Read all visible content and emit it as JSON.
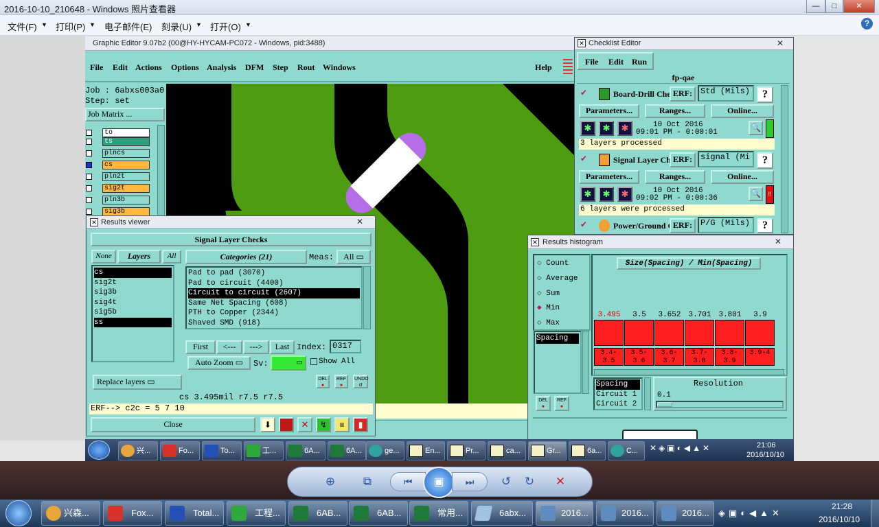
{
  "viewer": {
    "title": "2016-10-10_210648 - Windows 照片查看器",
    "menus": [
      "文件(F)",
      "打印(P)",
      "电子邮件(E)",
      "刻录(U)",
      "打开(O)"
    ],
    "help": "?",
    "min": "—",
    "max": "□",
    "close": "✕"
  },
  "graphic_editor": {
    "title": "Graphic Editor 9.07b2 (00@HY-HYCAM-PC072 - Windows, pid:3488)",
    "menus": [
      "File",
      "Edit",
      "Actions",
      "Options",
      "Analysis",
      "DFM",
      "Step",
      "Rout",
      "Windows"
    ],
    "help": "Help",
    "job": "Job : 6abxs003a0",
    "step": "Step: set",
    "job_matrix": "Job Matrix ...",
    "layers": [
      {
        "name": "to",
        "color": "#ffffff"
      },
      {
        "name": "ts",
        "color": "#2e9e7c"
      },
      {
        "name": "plncs",
        "color": "#8fd9cf"
      },
      {
        "name": "cs",
        "color": "#ffb83f"
      },
      {
        "name": "pln2t",
        "color": "#8fd9cf"
      },
      {
        "name": "sig2t",
        "color": "#ffb83f"
      },
      {
        "name": "pln3b",
        "color": "#8fd9cf"
      },
      {
        "name": "sig3b",
        "color": "#ffb83f"
      }
    ]
  },
  "checklist": {
    "title": "Checklist Editor",
    "menus": [
      "File",
      "Edit",
      "Run"
    ],
    "name": "fp-qae",
    "items": [
      {
        "label": "Board-Drill Che",
        "erf": "ERF:",
        "erf_value": "Std (Mils)",
        "date": "10 Oct 2016",
        "time": "09:01 PM - 0:00:01",
        "status": "3 layers processed",
        "status_color": "#2ecc2e"
      },
      {
        "label": "Signal Layer Ch",
        "erf": "ERF:",
        "erf_value": "signal (Mi",
        "date": "10 Oct 2016",
        "time": "09:02 PM - 0:00:36",
        "status": "6 layers were processed",
        "status_color": "#e01010"
      },
      {
        "label": "Power/Ground C",
        "erf": "ERF:",
        "erf_value": "P/G (Mils)"
      }
    ],
    "parameters": "Parameters...",
    "ranges": "Ranges...",
    "online": "Online..."
  },
  "results_viewer": {
    "title": "Results viewer",
    "heading": "Signal Layer Checks",
    "none_btn": "None",
    "layers_btn": "Layers",
    "all_btn": "All",
    "layers": [
      "cs",
      "sig2t",
      "sig3b",
      "sig4t",
      "sig5b",
      "ss"
    ],
    "categories_btn": "Categories (21)",
    "meas_label": "Meas:",
    "meas_value": "All",
    "categories": [
      "Pad to pad (3070)",
      "Pad to circuit (4400)",
      "Circuit to circuit (2607)",
      "Same Net Spacing (608)",
      "PTH to Copper (2344)",
      "Shaved SMD (918)"
    ],
    "first": "First",
    "prev": "<---",
    "next": "--->",
    "last": "Last",
    "index_label": "Index:",
    "index_value": "0317",
    "auto_zoom": "Auto Zoom",
    "sv_label": "Sv:",
    "show_all": "Show All",
    "replace_layers": "Replace layers",
    "del": "DEL",
    "ref": "REF",
    "undo": "UNDO",
    "measure": "cs 3.495mil   r7.5   r7.5",
    "erf_line": "ERF--> c2c = 5 7 10",
    "close": "Close"
  },
  "histogram": {
    "title": "Results histogram",
    "options": [
      "Count",
      "Average",
      "Sum",
      "Min",
      "Max"
    ],
    "selected_option": "Min",
    "list": [
      "Spacing"
    ],
    "chart_title": "Size(Spacing) / Min(Spacing)",
    "bars": [
      {
        "value": "3.495",
        "range": "3.4-3.5"
      },
      {
        "value": "3.5",
        "range": "3.5-3.6"
      },
      {
        "value": "3.652",
        "range": "3.6-3.7"
      },
      {
        "value": "3.701",
        "range": "3.7-3.8"
      },
      {
        "value": "3.801",
        "range": "3.8-3.9"
      },
      {
        "value": "3.9",
        "range": "3.9-4"
      }
    ],
    "columns": [
      "Spacing",
      "Circuit 1",
      "Circuit 2"
    ],
    "resolution_label": "Resolution",
    "resolution_value": "0.1",
    "del": "DEL",
    "ref": "REF"
  },
  "inner_taskbar": {
    "items": [
      "兴...",
      "Fo...",
      "To...",
      "工...",
      "6A...",
      "6A...",
      "ge...",
      "En...",
      "Pr...",
      "ca...",
      "Gr...",
      "6a...",
      "C..."
    ],
    "clock_time": "21:06",
    "clock_date": "2016/10/10"
  },
  "outer_taskbar": {
    "items": [
      "兴森...",
      "Fox...",
      "Total...",
      "工程...",
      "6AB...",
      "6AB...",
      "常用...",
      "6abx...",
      "2016...",
      "2016...",
      "2016..."
    ],
    "clock_time": "21:28",
    "clock_date": "2016/10/10"
  }
}
